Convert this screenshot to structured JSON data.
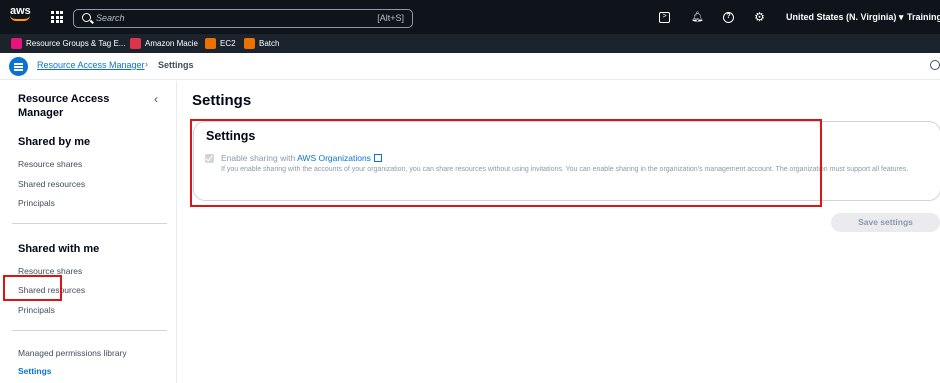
{
  "topbar": {
    "logo": "aws",
    "search_placeholder": "Search",
    "search_shortcut": "[Alt+S]",
    "region": "United States (N. Virginia) ▾",
    "account": "Training ▾"
  },
  "favorites": [
    {
      "label": "Resource Groups & Tag E...",
      "icon": "resource-groups-icon",
      "color": "#e7157b"
    },
    {
      "label": "Amazon Macie",
      "icon": "macie-icon",
      "color": "#dd344c"
    },
    {
      "label": "EC2",
      "icon": "ec2-icon",
      "color": "#ed7100"
    },
    {
      "label": "Batch",
      "icon": "batch-icon",
      "color": "#ed7100"
    }
  ],
  "breadcrumb": {
    "service": "Resource Access Manager",
    "separator": "›",
    "current": "Settings"
  },
  "sidebar": {
    "title": "Resource Access Manager",
    "collapse": "‹",
    "shared_by_me": {
      "heading": "Shared by me",
      "items": [
        "Resource shares",
        "Shared resources",
        "Principals"
      ]
    },
    "shared_with_me": {
      "heading": "Shared with me",
      "items": [
        "Resource shares",
        "Shared resources",
        "Principals"
      ]
    },
    "bottom_items": [
      "Managed permissions library",
      "Settings"
    ]
  },
  "main": {
    "page_title": "Settings",
    "panel_title": "Settings",
    "checkbox_label_prefix": "Enable sharing with ",
    "checkbox_link": "AWS Organizations",
    "checkbox_checked": true,
    "checkbox_disabled": true,
    "description": "If you enable sharing with the accounts of your organization, you can share resources without using invitations. You can enable sharing in the organization's management account. The organization must support all features.",
    "save_button": "Save settings"
  },
  "colors": {
    "accent": "#0972d3",
    "highlight_box": "#d91515",
    "topbar_bg": "#0f141a"
  }
}
